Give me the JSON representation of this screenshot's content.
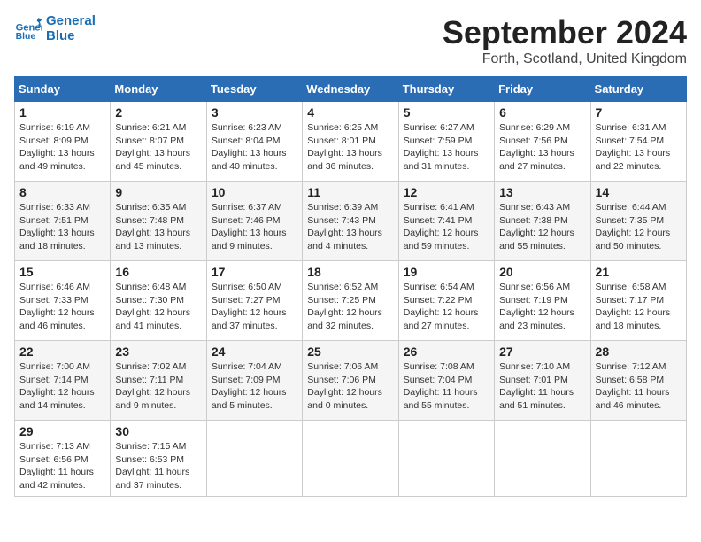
{
  "header": {
    "logo_line1": "General",
    "logo_line2": "Blue",
    "month_title": "September 2024",
    "location": "Forth, Scotland, United Kingdom"
  },
  "weekdays": [
    "Sunday",
    "Monday",
    "Tuesday",
    "Wednesday",
    "Thursday",
    "Friday",
    "Saturday"
  ],
  "weeks": [
    [
      {
        "day": "1",
        "sunrise": "6:19 AM",
        "sunset": "8:09 PM",
        "daylight": "13 hours and 49 minutes."
      },
      {
        "day": "2",
        "sunrise": "6:21 AM",
        "sunset": "8:07 PM",
        "daylight": "13 hours and 45 minutes."
      },
      {
        "day": "3",
        "sunrise": "6:23 AM",
        "sunset": "8:04 PM",
        "daylight": "13 hours and 40 minutes."
      },
      {
        "day": "4",
        "sunrise": "6:25 AM",
        "sunset": "8:01 PM",
        "daylight": "13 hours and 36 minutes."
      },
      {
        "day": "5",
        "sunrise": "6:27 AM",
        "sunset": "7:59 PM",
        "daylight": "13 hours and 31 minutes."
      },
      {
        "day": "6",
        "sunrise": "6:29 AM",
        "sunset": "7:56 PM",
        "daylight": "13 hours and 27 minutes."
      },
      {
        "day": "7",
        "sunrise": "6:31 AM",
        "sunset": "7:54 PM",
        "daylight": "13 hours and 22 minutes."
      }
    ],
    [
      {
        "day": "8",
        "sunrise": "6:33 AM",
        "sunset": "7:51 PM",
        "daylight": "13 hours and 18 minutes."
      },
      {
        "day": "9",
        "sunrise": "6:35 AM",
        "sunset": "7:48 PM",
        "daylight": "13 hours and 13 minutes."
      },
      {
        "day": "10",
        "sunrise": "6:37 AM",
        "sunset": "7:46 PM",
        "daylight": "13 hours and 9 minutes."
      },
      {
        "day": "11",
        "sunrise": "6:39 AM",
        "sunset": "7:43 PM",
        "daylight": "13 hours and 4 minutes."
      },
      {
        "day": "12",
        "sunrise": "6:41 AM",
        "sunset": "7:41 PM",
        "daylight": "12 hours and 59 minutes."
      },
      {
        "day": "13",
        "sunrise": "6:43 AM",
        "sunset": "7:38 PM",
        "daylight": "12 hours and 55 minutes."
      },
      {
        "day": "14",
        "sunrise": "6:44 AM",
        "sunset": "7:35 PM",
        "daylight": "12 hours and 50 minutes."
      }
    ],
    [
      {
        "day": "15",
        "sunrise": "6:46 AM",
        "sunset": "7:33 PM",
        "daylight": "12 hours and 46 minutes."
      },
      {
        "day": "16",
        "sunrise": "6:48 AM",
        "sunset": "7:30 PM",
        "daylight": "12 hours and 41 minutes."
      },
      {
        "day": "17",
        "sunrise": "6:50 AM",
        "sunset": "7:27 PM",
        "daylight": "12 hours and 37 minutes."
      },
      {
        "day": "18",
        "sunrise": "6:52 AM",
        "sunset": "7:25 PM",
        "daylight": "12 hours and 32 minutes."
      },
      {
        "day": "19",
        "sunrise": "6:54 AM",
        "sunset": "7:22 PM",
        "daylight": "12 hours and 27 minutes."
      },
      {
        "day": "20",
        "sunrise": "6:56 AM",
        "sunset": "7:19 PM",
        "daylight": "12 hours and 23 minutes."
      },
      {
        "day": "21",
        "sunrise": "6:58 AM",
        "sunset": "7:17 PM",
        "daylight": "12 hours and 18 minutes."
      }
    ],
    [
      {
        "day": "22",
        "sunrise": "7:00 AM",
        "sunset": "7:14 PM",
        "daylight": "12 hours and 14 minutes."
      },
      {
        "day": "23",
        "sunrise": "7:02 AM",
        "sunset": "7:11 PM",
        "daylight": "12 hours and 9 minutes."
      },
      {
        "day": "24",
        "sunrise": "7:04 AM",
        "sunset": "7:09 PM",
        "daylight": "12 hours and 5 minutes."
      },
      {
        "day": "25",
        "sunrise": "7:06 AM",
        "sunset": "7:06 PM",
        "daylight": "12 hours and 0 minutes."
      },
      {
        "day": "26",
        "sunrise": "7:08 AM",
        "sunset": "7:04 PM",
        "daylight": "11 hours and 55 minutes."
      },
      {
        "day": "27",
        "sunrise": "7:10 AM",
        "sunset": "7:01 PM",
        "daylight": "11 hours and 51 minutes."
      },
      {
        "day": "28",
        "sunrise": "7:12 AM",
        "sunset": "6:58 PM",
        "daylight": "11 hours and 46 minutes."
      }
    ],
    [
      {
        "day": "29",
        "sunrise": "7:13 AM",
        "sunset": "6:56 PM",
        "daylight": "11 hours and 42 minutes."
      },
      {
        "day": "30",
        "sunrise": "7:15 AM",
        "sunset": "6:53 PM",
        "daylight": "11 hours and 37 minutes."
      },
      null,
      null,
      null,
      null,
      null
    ]
  ]
}
